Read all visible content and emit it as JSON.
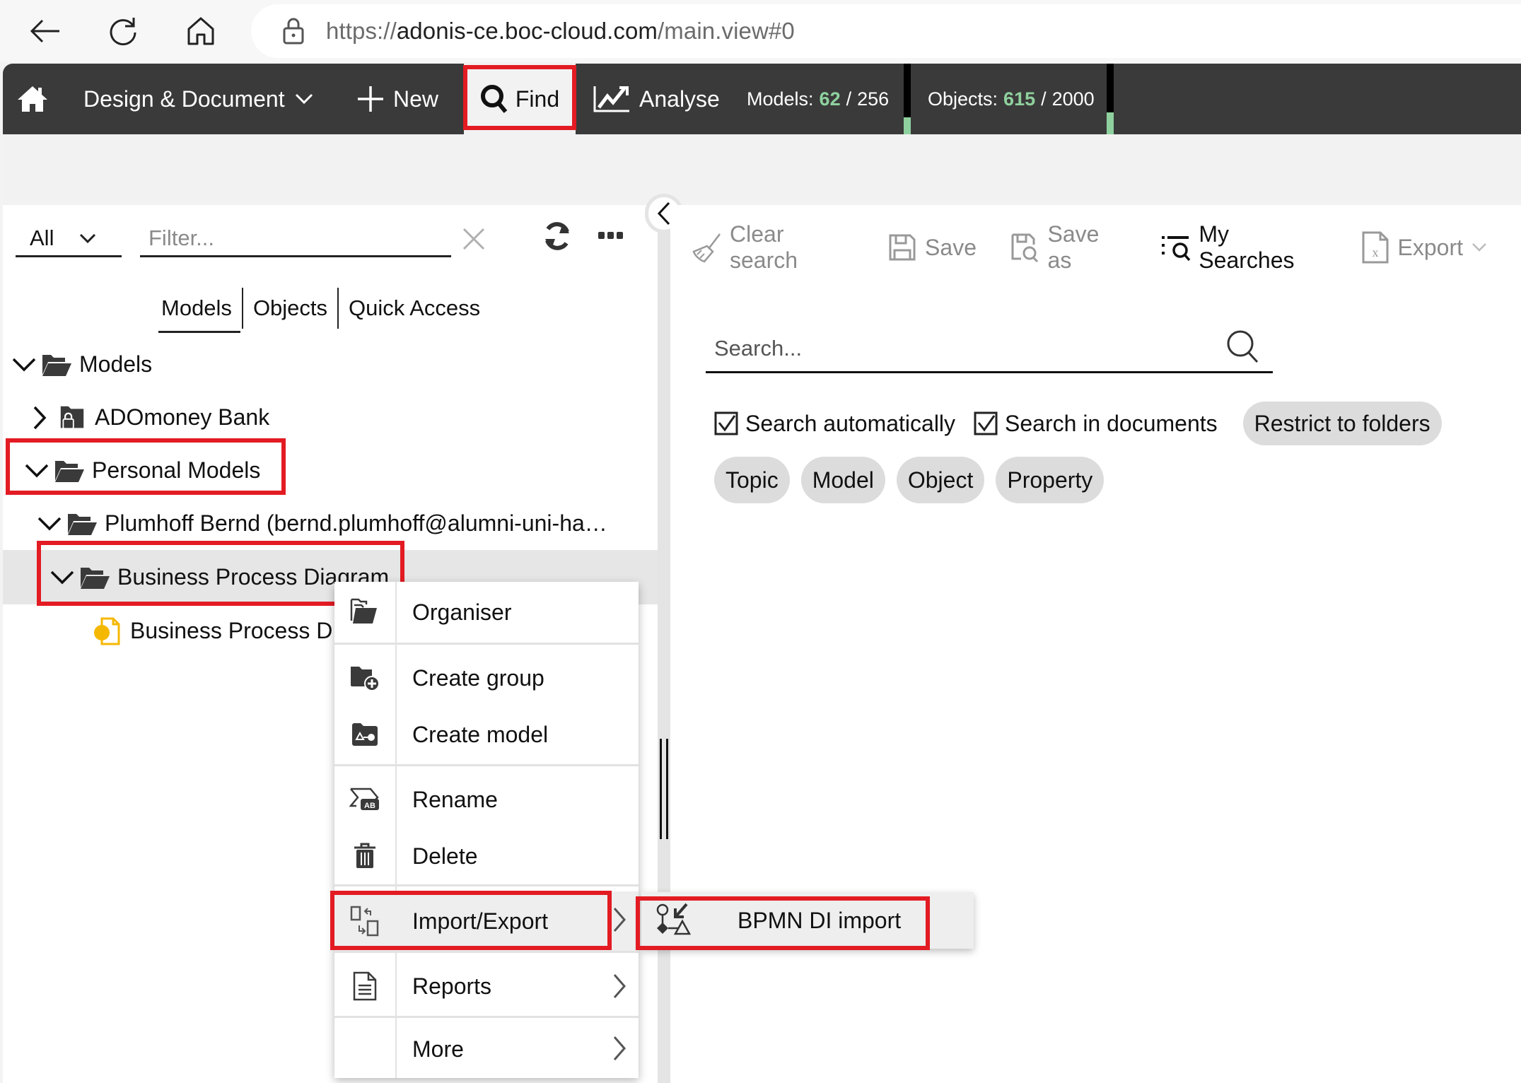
{
  "browser": {
    "url_prefix": "https://",
    "url_host": "adonis-ce.boc-cloud.com",
    "url_path": "/main.view#0",
    "icons": [
      "back-arrow-icon",
      "reload-icon",
      "home-icon",
      "lock-icon"
    ]
  },
  "appbar": {
    "home_icon": "home-icon",
    "design_label": "Design & Document",
    "new_label": "New",
    "find_label": "Find",
    "analyse_label": "Analyse",
    "models_label": "Models:",
    "models_used": "62",
    "models_sep": "/",
    "models_total": "256",
    "models_usage_fraction": 0.24,
    "objects_label": "Objects:",
    "objects_used": "615",
    "objects_sep": "/",
    "objects_total": "2000",
    "objects_usage_fraction": 0.31,
    "accent_color": "#8fd19e",
    "highlight_color": "#e31b23"
  },
  "left_panel": {
    "filter_select_value": "All",
    "filter_placeholder": "Filter...",
    "tabs": [
      {
        "label": "Models",
        "active": true
      },
      {
        "label": "Objects",
        "active": false
      },
      {
        "label": "Quick Access",
        "active": false
      }
    ],
    "tree": [
      {
        "label": "Models",
        "expanded": true,
        "icon": "folder-open-icon"
      },
      {
        "label": "ADOmoney Bank",
        "expanded": false,
        "icon": "folder-locked-icon"
      },
      {
        "label": "Personal Models",
        "expanded": true,
        "icon": "folder-open-icon"
      },
      {
        "label": "Plumhoff Bernd (bernd.plumhoff@alumni-uni-ha…",
        "expanded": true,
        "icon": "folder-open-icon"
      },
      {
        "label": "Business Process Diagram",
        "expanded": true,
        "icon": "folder-open-icon",
        "selected": true
      },
      {
        "label": "Business Process D",
        "icon": "bpmn-model-icon"
      }
    ]
  },
  "toolbar": {
    "clear_search": "Clear search",
    "save": "Save",
    "save_as": "Save as",
    "my_searches": "My Searches",
    "export": "Export"
  },
  "search": {
    "placeholder": "Search...",
    "search_automatically": "Search automatically",
    "search_automatically_checked": true,
    "search_in_documents": "Search in documents",
    "search_in_documents_checked": true,
    "restrict_to_folders": "Restrict to folders",
    "chips": [
      "Topic",
      "Model",
      "Object",
      "Property"
    ]
  },
  "context_menu": {
    "items": [
      {
        "label": "Organiser",
        "icon": "organiser-icon"
      },
      {
        "label": "Create group",
        "icon": "create-group-icon"
      },
      {
        "label": "Create model",
        "icon": "create-model-icon"
      },
      {
        "label": "Rename",
        "icon": "rename-icon"
      },
      {
        "label": "Delete",
        "icon": "trash-icon"
      },
      {
        "label": "Import/Export",
        "icon": "import-export-icon",
        "submenu": true
      },
      {
        "label": "Reports",
        "icon": "report-icon",
        "submenu": true
      },
      {
        "label": "More",
        "icon": "",
        "submenu": true
      }
    ],
    "submenu": {
      "label": "BPMN DI import",
      "icon": "bpmn-import-icon"
    }
  }
}
